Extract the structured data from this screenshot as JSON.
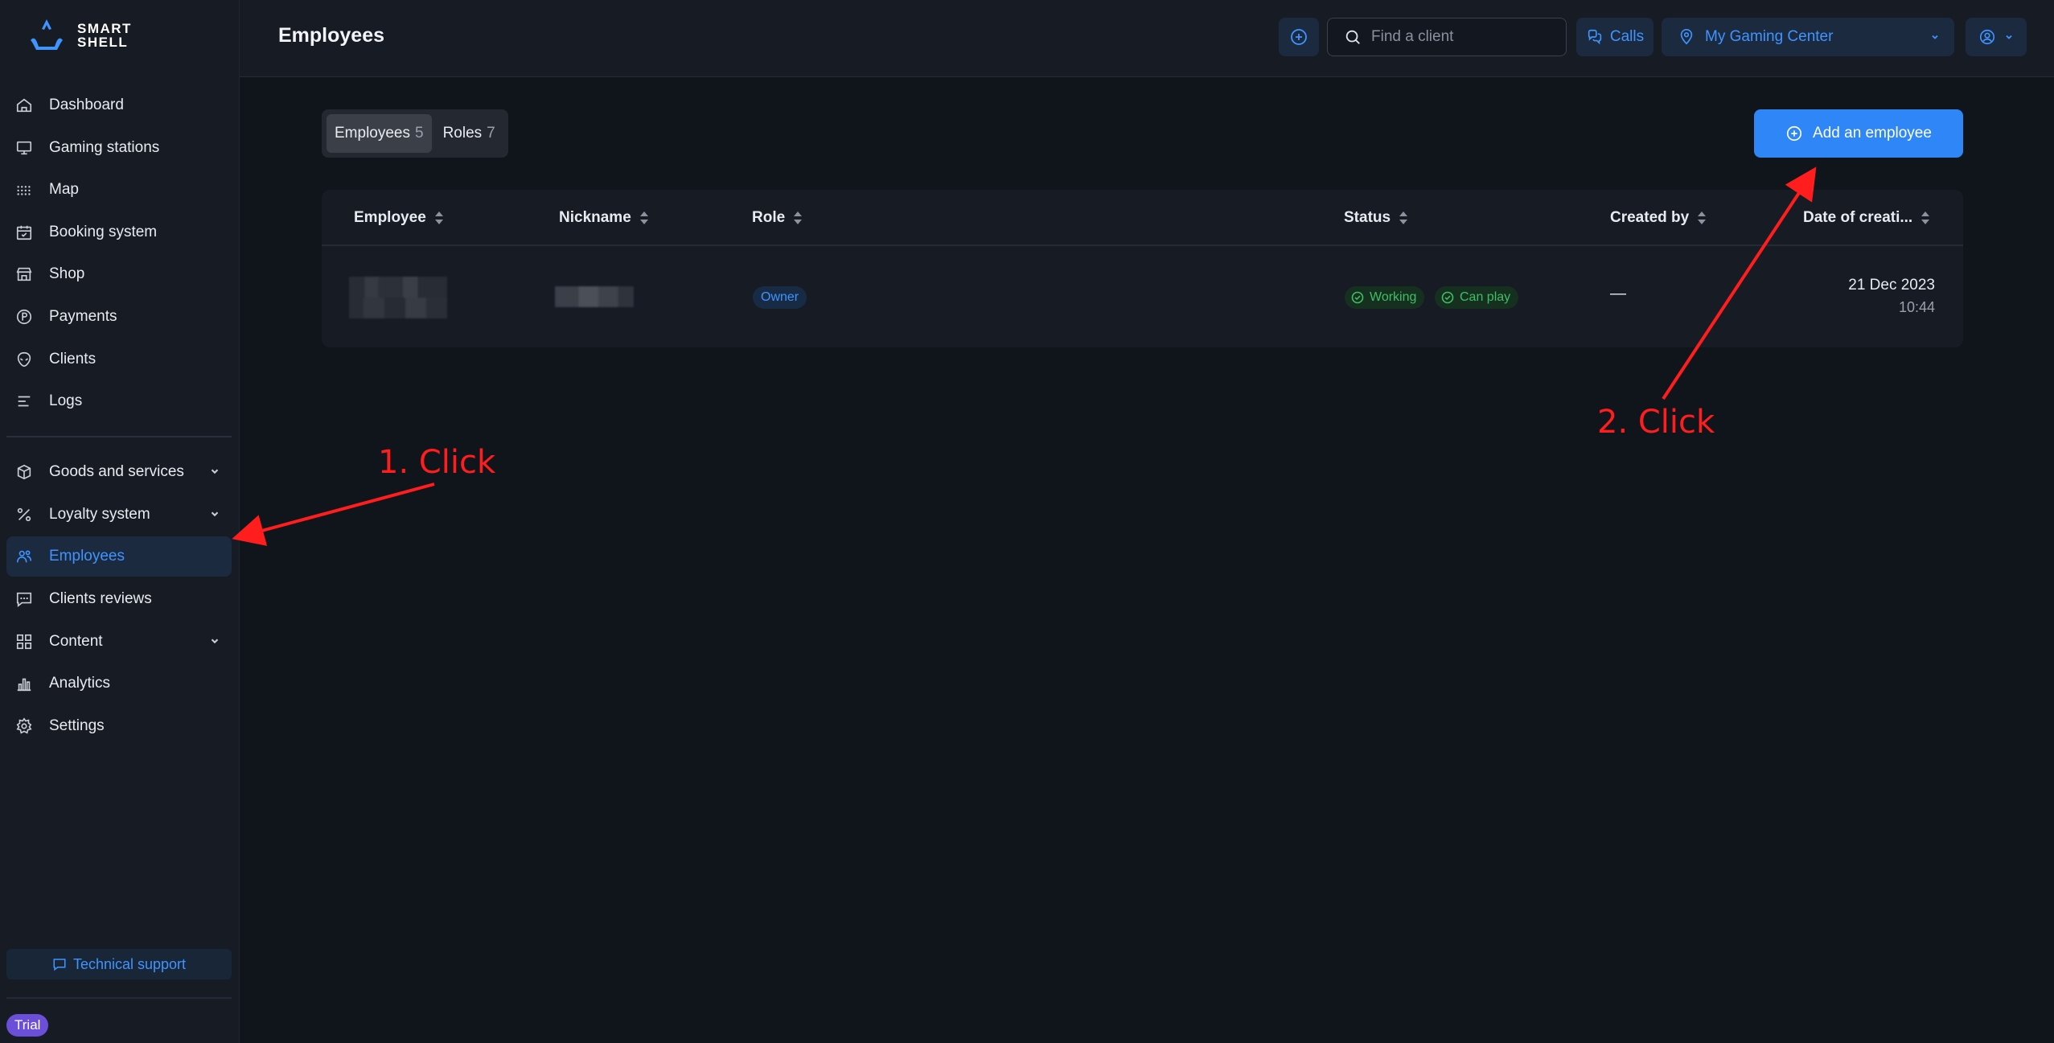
{
  "brand": {
    "line1": "SMART",
    "line2": "SHELL"
  },
  "sidebar": {
    "items": [
      {
        "label": "Dashboard",
        "icon": "home-icon"
      },
      {
        "label": "Gaming stations",
        "icon": "monitor-icon"
      },
      {
        "label": "Map",
        "icon": "grid-dots-icon"
      },
      {
        "label": "Booking system",
        "icon": "calendar-icon"
      },
      {
        "label": "Shop",
        "icon": "store-icon"
      },
      {
        "label": "Payments",
        "icon": "currency-icon"
      },
      {
        "label": "Clients",
        "icon": "alien-icon"
      },
      {
        "label": "Logs",
        "icon": "lines-icon"
      }
    ],
    "groups": [
      {
        "label": "Goods and services",
        "icon": "box-icon",
        "expandable": true
      },
      {
        "label": "Loyalty system",
        "icon": "percent-icon",
        "expandable": true
      },
      {
        "label": "Employees",
        "icon": "users-icon",
        "active": true
      },
      {
        "label": "Clients reviews",
        "icon": "chat-icon"
      },
      {
        "label": "Content",
        "icon": "apps-icon",
        "expandable": true
      },
      {
        "label": "Analytics",
        "icon": "bar-chart-icon"
      },
      {
        "label": "Settings",
        "icon": "gear-icon"
      }
    ],
    "tech_support": "Technical support",
    "trial": "Trial"
  },
  "header": {
    "title": "Employees",
    "search_placeholder": "Find a client",
    "calls": "Calls",
    "center": "My Gaming Center"
  },
  "tabs": [
    {
      "label": "Employees",
      "count": "5"
    },
    {
      "label": "Roles",
      "count": "7"
    }
  ],
  "add_button": "Add an employee",
  "table": {
    "columns": [
      "Employee",
      "Nickname",
      "Role",
      "Status",
      "Created by",
      "Date of creati..."
    ],
    "rows": [
      {
        "role": "Owner",
        "status": [
          "Working",
          "Can play"
        ],
        "created_by": "—",
        "date": "21 Dec 2023",
        "time": "10:44"
      }
    ]
  },
  "annotations": {
    "step1": "1. Click",
    "step2": "2. Click"
  },
  "colors": {
    "accent": "#3f94ff",
    "annotation": "#ff1d1d",
    "success": "#3fbf64",
    "trial": "#6b4fd8"
  }
}
